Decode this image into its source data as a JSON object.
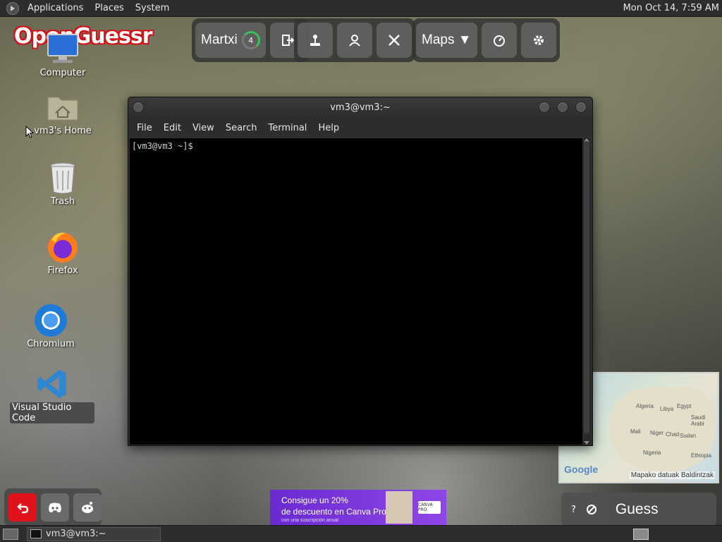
{
  "top_panel": {
    "menu": [
      "Applications",
      "Places",
      "System"
    ],
    "clock": "Mon Oct 14,  7:59 AM"
  },
  "game": {
    "logo": "OpenGuessr",
    "player_name": "Martxi",
    "player_level": "4",
    "maps_label": "Maps ▼",
    "guess_label": "Guess",
    "help_label": "?"
  },
  "desktop_icons": [
    {
      "label": "Computer"
    },
    {
      "label": "vm3's Home"
    },
    {
      "label": "Trash"
    },
    {
      "label": "Firefox"
    },
    {
      "label": "Chromium"
    },
    {
      "label": "Visual Studio Code"
    }
  ],
  "terminal": {
    "title": "vm3@vm3:~",
    "menu": [
      "File",
      "Edit",
      "View",
      "Search",
      "Terminal",
      "Help"
    ],
    "prompt": "[vm3@vm3 ~]$"
  },
  "minimap": {
    "labels": [
      "Algeria",
      "Libya",
      "Egypt",
      "Mali",
      "Niger",
      "Chad",
      "Sudan",
      "Nigeria",
      "Ethiopia",
      "Saudi Arabi"
    ],
    "google": "Google",
    "footer": "Mapako datuak  Baldintzak"
  },
  "ad": {
    "line1": "Consigue un 20%",
    "line2": "de descuento en Canva Pro",
    "line3": "con una suscripción anual",
    "brand": "CANVA PRO"
  },
  "taskbar": {
    "window_label": "vm3@vm3:~"
  }
}
